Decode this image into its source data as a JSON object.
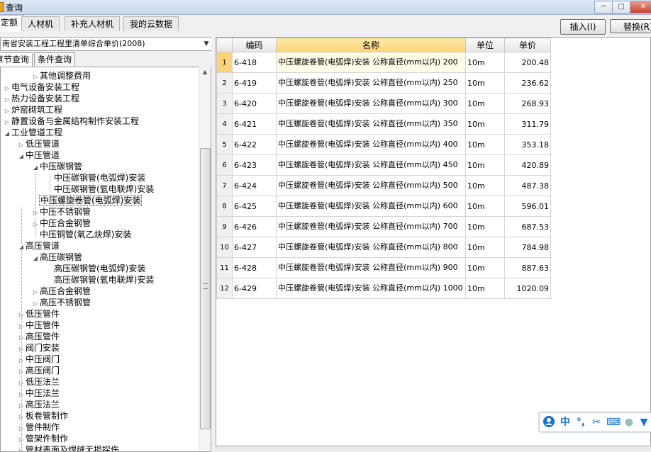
{
  "window": {
    "title": "查询"
  },
  "tabs": [
    {
      "label": "定额",
      "active": true
    },
    {
      "label": "人材机",
      "active": false
    },
    {
      "label": "补充人材机",
      "active": false
    },
    {
      "label": "我的云数据",
      "active": false
    }
  ],
  "actions": {
    "insert": "插入(I)",
    "replace": "替换(R)"
  },
  "library": {
    "selected": "南省安装工程工程里清单综合单价(2008)"
  },
  "subtabs": [
    {
      "label": "章节查询",
      "active": true
    },
    {
      "label": "条件查询",
      "active": false
    }
  ],
  "tree": [
    {
      "label": "其他调整费用",
      "level": 2,
      "toggle": "▷"
    },
    {
      "label": "电气设备安装工程",
      "level": 0,
      "toggle": "▷"
    },
    {
      "label": "热力设备安装工程",
      "level": 0,
      "toggle": "▷"
    },
    {
      "label": "炉窑砌筑工程",
      "level": 0,
      "toggle": "▷"
    },
    {
      "label": "静置设备与金属结构制作安装工程",
      "level": 0,
      "toggle": "▷"
    },
    {
      "label": "工业管道工程",
      "level": 0,
      "toggle": "◢"
    },
    {
      "label": "低压管道",
      "level": 1,
      "toggle": "▷"
    },
    {
      "label": "中压管道",
      "level": 1,
      "toggle": "◢"
    },
    {
      "label": "中压碳钢管",
      "level": 2,
      "toggle": "◢"
    },
    {
      "label": "中压碳钢管(电弧焊)安装",
      "level": 3,
      "toggle": ""
    },
    {
      "label": "中压碳钢管(氩电联焊)安装",
      "level": 3,
      "toggle": ""
    },
    {
      "label": "中压螺旋卷管(电弧焊)安装",
      "level": 2,
      "toggle": "",
      "selected": true
    },
    {
      "label": "中压不锈钢管",
      "level": 2,
      "toggle": "▷"
    },
    {
      "label": "中压合金钢管",
      "level": 2,
      "toggle": "▷"
    },
    {
      "label": "中压铜管(氧乙炔焊)安装",
      "level": 2,
      "toggle": ""
    },
    {
      "label": "高压管道",
      "level": 1,
      "toggle": "◢"
    },
    {
      "label": "高压碳钢管",
      "level": 2,
      "toggle": "◢"
    },
    {
      "label": "高压碳钢管(电弧焊)安装",
      "level": 3,
      "toggle": ""
    },
    {
      "label": "高压碳钢管(氩电联焊)安装",
      "level": 3,
      "toggle": ""
    },
    {
      "label": "高压合金钢管",
      "level": 2,
      "toggle": "▷"
    },
    {
      "label": "高压不锈钢管",
      "level": 2,
      "toggle": "▷"
    },
    {
      "label": "低压管件",
      "level": 1,
      "toggle": "▷"
    },
    {
      "label": "中压管件",
      "level": 1,
      "toggle": "▷"
    },
    {
      "label": "高压管件",
      "level": 1,
      "toggle": "▷"
    },
    {
      "label": "阀门安装",
      "level": 1,
      "toggle": "▷"
    },
    {
      "label": "中压阀门",
      "level": 1,
      "toggle": "▷"
    },
    {
      "label": "高压阀门",
      "level": 1,
      "toggle": "▷"
    },
    {
      "label": "低压法兰",
      "level": 1,
      "toggle": "▷"
    },
    {
      "label": "中压法兰",
      "level": 1,
      "toggle": "▷"
    },
    {
      "label": "高压法兰",
      "level": 1,
      "toggle": "▷"
    },
    {
      "label": "板卷管制作",
      "level": 1,
      "toggle": "▷"
    },
    {
      "label": "管件制作",
      "level": 1,
      "toggle": "▷"
    },
    {
      "label": "管架件制作",
      "level": 1,
      "toggle": "▷"
    },
    {
      "label": "管材表面及焊缝无损探伤",
      "level": 1,
      "toggle": "▷"
    }
  ],
  "grid": {
    "headers": {
      "code": "编码",
      "name": "名称",
      "unit": "单位",
      "price": "单价"
    },
    "rows": [
      {
        "no": "1",
        "code": "6-418",
        "name": "中压螺旋卷管(电弧焊)安装 公称直径(mm以内) 200",
        "unit": "10m",
        "price": "200.48"
      },
      {
        "no": "2",
        "code": "6-419",
        "name": "中压螺旋卷管(电弧焊)安装 公称直径(mm以内) 250",
        "unit": "10m",
        "price": "236.62"
      },
      {
        "no": "3",
        "code": "6-420",
        "name": "中压螺旋卷管(电弧焊)安装 公称直径(mm以内) 300",
        "unit": "10m",
        "price": "268.93"
      },
      {
        "no": "4",
        "code": "6-421",
        "name": "中压螺旋卷管(电弧焊)安装 公称直径(mm以内) 350",
        "unit": "10m",
        "price": "311.79"
      },
      {
        "no": "5",
        "code": "6-422",
        "name": "中压螺旋卷管(电弧焊)安装 公称直径(mm以内) 400",
        "unit": "10m",
        "price": "353.18"
      },
      {
        "no": "6",
        "code": "6-423",
        "name": "中压螺旋卷管(电弧焊)安装 公称直径(mm以内) 450",
        "unit": "10m",
        "price": "420.89"
      },
      {
        "no": "7",
        "code": "6-424",
        "name": "中压螺旋卷管(电弧焊)安装 公称直径(mm以内) 500",
        "unit": "10m",
        "price": "487.38"
      },
      {
        "no": "8",
        "code": "6-425",
        "name": "中压螺旋卷管(电弧焊)安装 公称直径(mm以内) 600",
        "unit": "10m",
        "price": "596.01"
      },
      {
        "no": "9",
        "code": "6-426",
        "name": "中压螺旋卷管(电弧焊)安装 公称直径(mm以内) 700",
        "unit": "10m",
        "price": "687.53"
      },
      {
        "no": "10",
        "code": "6-427",
        "name": "中压螺旋卷管(电弧焊)安装 公称直径(mm以内) 800",
        "unit": "10m",
        "price": "784.98"
      },
      {
        "no": "11",
        "code": "6-428",
        "name": "中压螺旋卷管(电弧焊)安装 公称直径(mm以内) 900",
        "unit": "10m",
        "price": "887.63"
      },
      {
        "no": "12",
        "code": "6-429",
        "name": "中压螺旋卷管(电弧焊)安装 公称直径(mm以内) 1000",
        "unit": "10m",
        "price": "1020.09"
      }
    ]
  },
  "ime": {
    "mode": "中",
    "punct": "°,"
  },
  "colors": {
    "header_highlight": "#fbd37a",
    "ime_accent": "#1a6fd6"
  }
}
